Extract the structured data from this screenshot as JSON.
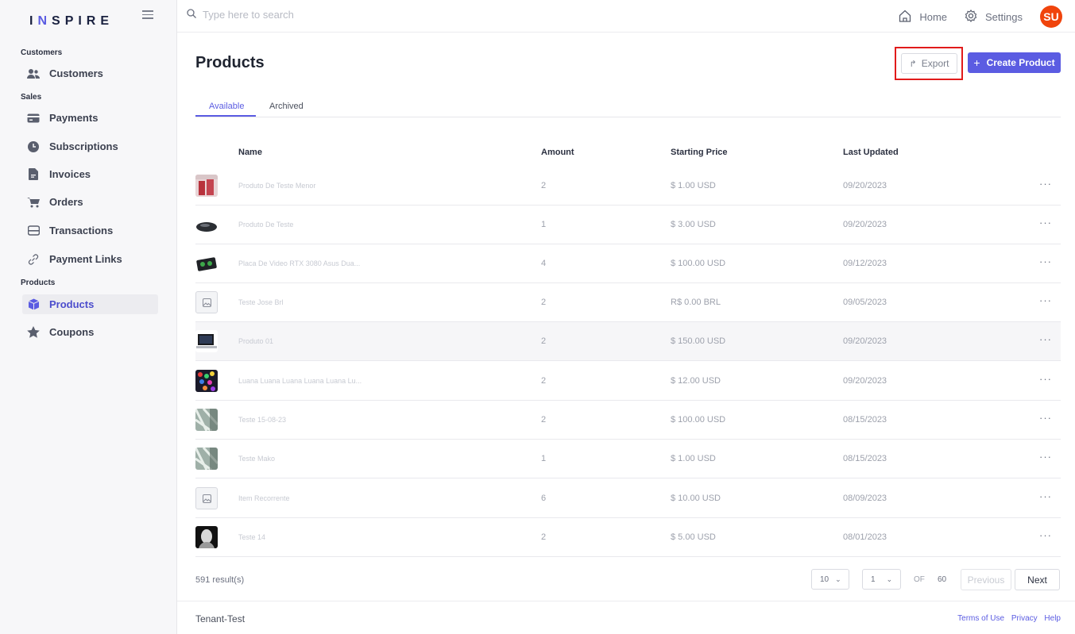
{
  "brand": {
    "prefix": "I",
    "n": "N",
    "rest": "SPIRE"
  },
  "search": {
    "placeholder": "Type here to search"
  },
  "topbar": {
    "home": "Home",
    "settings": "Settings",
    "avatar": "SU"
  },
  "sidebar": {
    "sections": {
      "customers": "Customers",
      "sales": "Sales",
      "products": "Products"
    },
    "items": [
      {
        "label": "Customers",
        "icon": "users-icon"
      },
      {
        "label": "Payments",
        "icon": "credit-card-icon"
      },
      {
        "label": "Subscriptions",
        "icon": "clock-icon"
      },
      {
        "label": "Invoices",
        "icon": "document-icon"
      },
      {
        "label": "Orders",
        "icon": "cart-icon"
      },
      {
        "label": "Transactions",
        "icon": "wallet-icon"
      },
      {
        "label": "Payment Links",
        "icon": "link-icon"
      },
      {
        "label": "Products",
        "icon": "box-icon",
        "active": true
      },
      {
        "label": "Coupons",
        "icon": "star-icon"
      }
    ]
  },
  "page": {
    "title": "Products",
    "export_label": "Export",
    "create_label": "Create Product",
    "tabs": [
      "Available",
      "Archived"
    ]
  },
  "table": {
    "headers": {
      "name": "Name",
      "amount": "Amount",
      "starting_price": "Starting Price",
      "last_updated": "Last Updated"
    },
    "more_label": "···",
    "rows": [
      {
        "name": "Produto De Teste Menor",
        "amount": "2",
        "price": "$ 1.00 USD",
        "date": "09/20/2023"
      },
      {
        "name": "Produto De Teste",
        "amount": "1",
        "price": "$ 3.00 USD",
        "date": "09/20/2023"
      },
      {
        "name": "Placa De Video RTX 3080 Asus Dua...",
        "amount": "4",
        "price": "$ 100.00 USD",
        "date": "09/12/2023"
      },
      {
        "name": "Teste Jose Brl",
        "amount": "2",
        "price": "R$ 0.00 BRL",
        "date": "09/05/2023"
      },
      {
        "name": "Produto 01",
        "amount": "2",
        "price": "$ 150.00 USD",
        "date": "09/20/2023"
      },
      {
        "name": "Luana Luana Luana Luana Luana Lu...",
        "amount": "2",
        "price": "$ 12.00 USD",
        "date": "09/20/2023"
      },
      {
        "name": "Teste 15-08-23",
        "amount": "2",
        "price": "$ 100.00 USD",
        "date": "08/15/2023"
      },
      {
        "name": "Teste Mako",
        "amount": "1",
        "price": "$ 1.00 USD",
        "date": "08/15/2023"
      },
      {
        "name": "Item Recorrente",
        "amount": "6",
        "price": "$ 10.00 USD",
        "date": "08/09/2023"
      },
      {
        "name": "Teste 14",
        "amount": "2",
        "price": "$ 5.00 USD",
        "date": "08/01/2023"
      }
    ]
  },
  "pagination": {
    "results": "591 result(s)",
    "page_size": "10",
    "current_page": "1",
    "of_label": "OF",
    "total_pages": "60",
    "previous": "Previous",
    "next": "Next"
  },
  "footer": {
    "tenant": "Tenant-Test",
    "terms": "Terms of Use",
    "privacy": "Privacy",
    "help": "Help"
  },
  "colors": {
    "accent": "#5b5ce2",
    "avatar": "#f0440c",
    "highlight": "#e11b1b"
  }
}
